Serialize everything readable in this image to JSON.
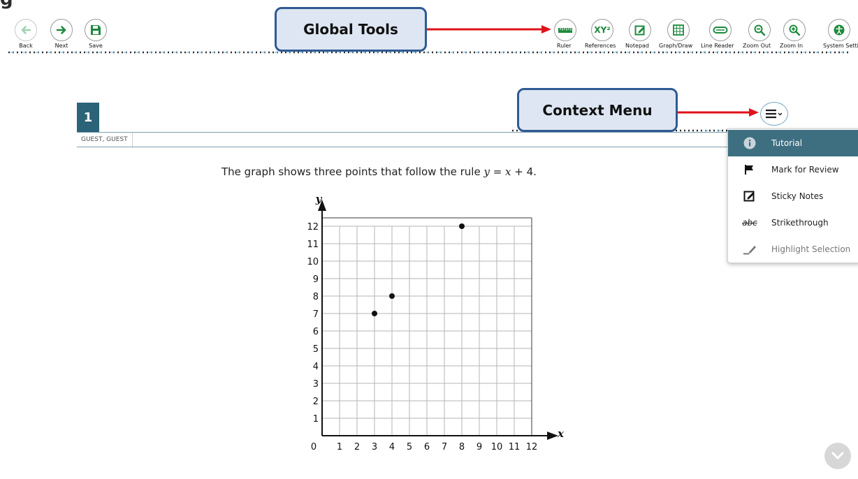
{
  "top_glyph": "g",
  "toolbar": {
    "nav": [
      {
        "label": "Back",
        "icon": "back-arrow-icon"
      },
      {
        "label": "Next",
        "icon": "next-arrow-icon"
      },
      {
        "label": "Save",
        "icon": "save-icon"
      }
    ],
    "tools": [
      {
        "label": "Ruler",
        "icon": "ruler-icon"
      },
      {
        "label": "References",
        "icon": "references-icon",
        "glyph": "XY²"
      },
      {
        "label": "Notepad",
        "icon": "notepad-icon"
      },
      {
        "label": "Graph/Draw",
        "icon": "graph-draw-icon"
      },
      {
        "label": "Line Reader",
        "icon": "line-reader-icon"
      },
      {
        "label": "Zoom Out",
        "icon": "zoom-out-icon"
      },
      {
        "label": "Zoom In",
        "icon": "zoom-in-icon"
      },
      {
        "label": "System Settin",
        "icon": "system-settings-icon"
      }
    ]
  },
  "callouts": {
    "global_tools": "Global Tools",
    "context_menu": "Context Menu"
  },
  "question": {
    "number": "1",
    "user": "GUEST, GUEST",
    "prompt_prefix": "The graph shows three points that follow the rule ",
    "rule_y": "y",
    "rule_mid": " = ",
    "rule_x": "x",
    "rule_suffix": " + 4."
  },
  "context_menu": {
    "items": [
      {
        "label": "Tutorial",
        "icon": "info-icon",
        "state": "active"
      },
      {
        "label": "Mark for Review",
        "icon": "flag-icon",
        "state": "normal"
      },
      {
        "label": "Sticky Notes",
        "icon": "sticky-note-icon",
        "state": "normal"
      },
      {
        "label": "Strikethrough",
        "icon": "strikethrough-icon",
        "state": "normal"
      },
      {
        "label": "Highlight Selection",
        "icon": "highlighter-icon",
        "state": "disabled"
      }
    ]
  },
  "chart_data": {
    "type": "scatter",
    "xlabel": "x",
    "ylabel": "y",
    "xlim": [
      0,
      12
    ],
    "ylim": [
      0,
      12
    ],
    "x_ticks": [
      "0",
      "1",
      "2",
      "3",
      "4",
      "5",
      "6",
      "7",
      "8",
      "9",
      "10",
      "11",
      "12"
    ],
    "y_ticks": [
      "1",
      "2",
      "3",
      "4",
      "5",
      "6",
      "7",
      "8",
      "9",
      "10",
      "11",
      "12"
    ],
    "grid": true,
    "points": [
      {
        "x": 3,
        "y": 7
      },
      {
        "x": 4,
        "y": 8
      },
      {
        "x": 8,
        "y": 12
      }
    ]
  },
  "colors": {
    "accent": "#2d6378",
    "nav_green": "#1e8a3c",
    "callout_border": "#2f5a93",
    "callout_fill": "#dde6f2",
    "arrow_red": "#e0121a",
    "menu_active": "#3d6f80"
  }
}
